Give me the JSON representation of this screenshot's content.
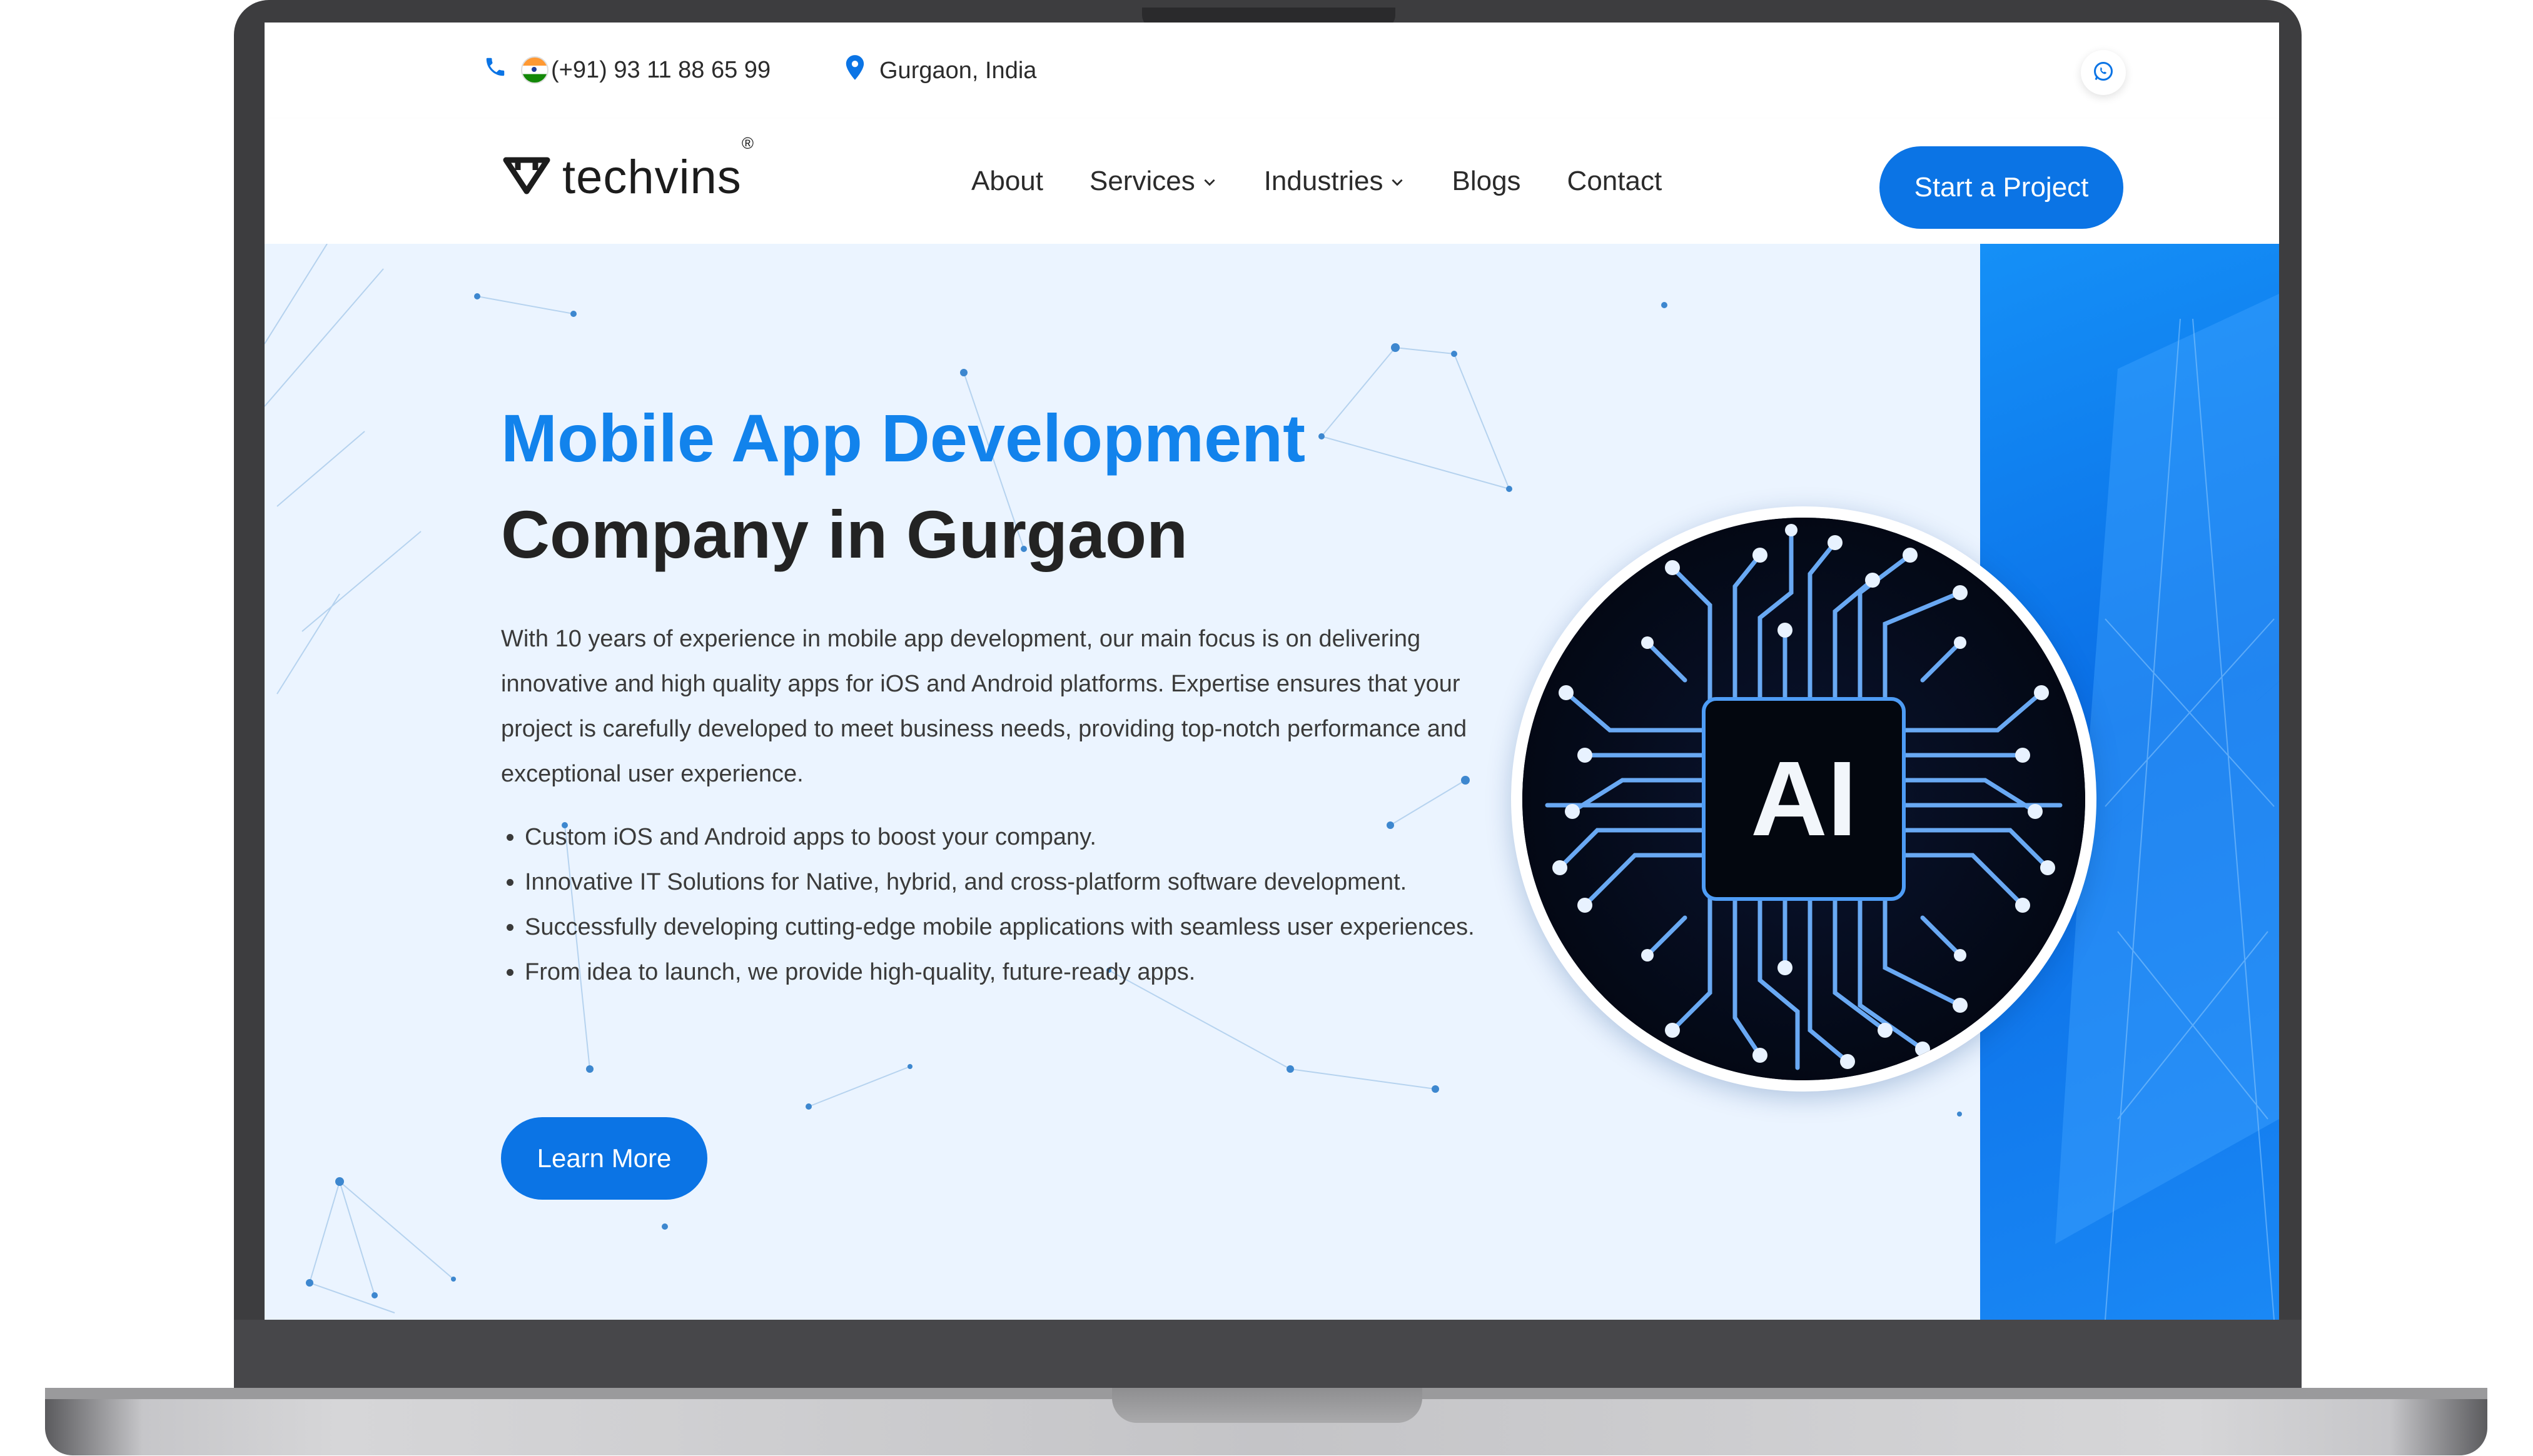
{
  "topbar": {
    "phone": "(+91) 93 11 88 65 99",
    "location": "Gurgaon, India"
  },
  "nav": {
    "logo_text": "techvins",
    "logo_mark": "®",
    "menu": [
      {
        "label": "About",
        "dropdown": false
      },
      {
        "label": "Services",
        "dropdown": true
      },
      {
        "label": "Industries",
        "dropdown": true
      },
      {
        "label": "Blogs",
        "dropdown": false
      },
      {
        "label": "Contact",
        "dropdown": false
      }
    ],
    "cta_label": "Start a Project"
  },
  "hero": {
    "title_line1": "Mobile App Development",
    "title_line2": "Company in Gurgaon",
    "intro": "With 10 years of experience in mobile app development, our main focus is on delivering innovative and high quality apps for iOS and Android platforms. Expertise ensures that your project is carefully developed to meet business needs, providing top-notch performance and exceptional user experience.",
    "bullets": [
      "Custom iOS and Android apps to boost your company.",
      "Innovative IT Solutions for Native, hybrid, and cross-platform software development.",
      "Successfully developing cutting-edge mobile applications with seamless user experiences.",
      "From idea to launch, we provide high-quality, future-ready apps."
    ],
    "button_label": "Learn More",
    "image_label": "AI"
  },
  "icons": {
    "phone": "phone-icon",
    "flag": "india-flag-icon",
    "location": "location-pin-icon",
    "whatsapp": "whatsapp-icon",
    "logo": "techvins-logo-icon",
    "chevron": "chevron-down-icon"
  },
  "colors": {
    "accent": "#0b74e5",
    "title_blue": "#1283ec",
    "hero_bg": "#ebf4ff",
    "text_dark": "#232323"
  }
}
